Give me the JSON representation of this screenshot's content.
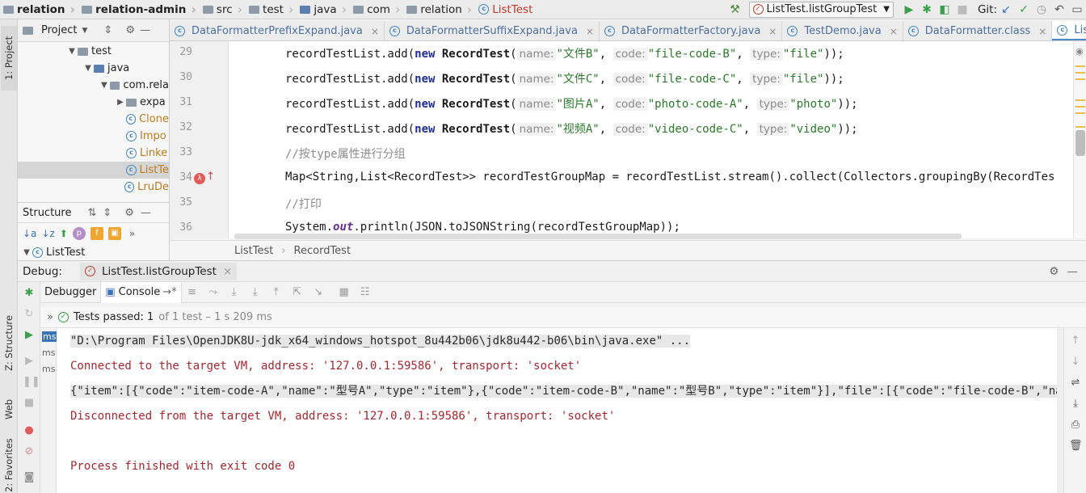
{
  "nav": {
    "items": [
      "relation",
      "relation-admin",
      "src",
      "test",
      "java",
      "com",
      "relation",
      "ListTest"
    ],
    "run_config": "ListTest.listGroupTest",
    "git_label": "Git:"
  },
  "left_strip": {
    "project_tab": "1: Project",
    "structure_tab": "Z: Structure",
    "web_tab": "Web",
    "favorites_tab": "2: Favorites"
  },
  "project": {
    "title": "Project",
    "tree": [
      {
        "label": "test",
        "depth": 0,
        "kind": "folder",
        "expanded": true
      },
      {
        "label": "java",
        "depth": 1,
        "kind": "folder-src",
        "expanded": true
      },
      {
        "label": "com.rela",
        "depth": 2,
        "kind": "package",
        "expanded": true
      },
      {
        "label": "expa",
        "depth": 3,
        "kind": "package",
        "expanded": false
      },
      {
        "label": "Clone",
        "depth": 3,
        "kind": "class"
      },
      {
        "label": "Impo",
        "depth": 3,
        "kind": "class"
      },
      {
        "label": "Linke",
        "depth": 3,
        "kind": "class"
      },
      {
        "label": "ListTe",
        "depth": 3,
        "kind": "class",
        "selected": true
      },
      {
        "label": "LruDe",
        "depth": 3,
        "kind": "class"
      }
    ]
  },
  "structure": {
    "title": "Structure",
    "root": "ListTest"
  },
  "tabs": [
    {
      "label": "DataFormatterPrefixExpand.java"
    },
    {
      "label": "DataFormatterSuffixExpand.java"
    },
    {
      "label": "DataFormatterFactory.java"
    },
    {
      "label": "TestDemo.java"
    },
    {
      "label": "DataFormatter.class"
    },
    {
      "label": "ListTest.java",
      "active": true
    }
  ],
  "tabs_more": "≡4",
  "editor": {
    "line_numbers": [
      "29",
      "30",
      "31",
      "32",
      "33",
      "34",
      "35",
      "36"
    ],
    "lines": [
      {
        "a": "recordTestList.add(",
        "b": "new ",
        "c": "RecordTest",
        "d": "(",
        "h1": "name:",
        "s1": "\"文件B\"",
        "h2": "code:",
        "s2": "\"file-code-B\"",
        "h3": "type:",
        "s3": "\"file\"",
        "e": "));"
      },
      {
        "a": "recordTestList.add(",
        "b": "new ",
        "c": "RecordTest",
        "d": "(",
        "h1": "name:",
        "s1": "\"文件C\"",
        "h2": "code:",
        "s2": "\"file-code-C\"",
        "h3": "type:",
        "s3": "\"file\"",
        "e": "));"
      },
      {
        "a": "recordTestList.add(",
        "b": "new ",
        "c": "RecordTest",
        "d": "(",
        "h1": "name:",
        "s1": "\"图片A\"",
        "h2": "code:",
        "s2": "\"photo-code-A\"",
        "h3": "type:",
        "s3": "\"photo\"",
        "e": "));"
      },
      {
        "a": "recordTestList.add(",
        "b": "new ",
        "c": "RecordTest",
        "d": "(",
        "h1": "name:",
        "s1": "\"视频A\"",
        "h2": "code:",
        "s2": "\"video-code-C\"",
        "h3": "type:",
        "s3": "\"video\"",
        "e": "));"
      }
    ],
    "comment1": "//按type属性进行分组",
    "line34": "Map<String,List<RecordTest>> recordTestGroupMap = recordTestList.stream().collect(Collectors.groupingBy(RecordTes",
    "comment2": "//打印",
    "line36a": "System.",
    "line36b": "out",
    "line36c": ".println(JSON.toJSONString(recordTestGroupMap));",
    "breadcrumb": [
      "ListTest",
      "RecordTest"
    ]
  },
  "debug": {
    "label": "Debug:",
    "session": "ListTest.listGroupTest",
    "tab_debugger": "Debugger",
    "tab_console": "Console",
    "tests_passed": "Tests passed: 1",
    "tests_of": "of 1 test – 1 s 209 ms",
    "ms_labels": [
      "ms",
      "ms",
      "ms"
    ]
  },
  "console": {
    "lines": [
      {
        "text": "\"D:\\Program Files\\OpenJDK8U-jdk_x64_windows_hotspot_8u442b06\\jdk8u442-b06\\bin\\java.exe\" ...",
        "style": "dark",
        "hl": true
      },
      {
        "text": "Connected to the target VM, address: '127.0.0.1:59586', transport: 'socket'",
        "style": "red"
      },
      {
        "text": "{\"item\":[{\"code\":\"item-code-A\",\"name\":\"型号A\",\"type\":\"item\"},{\"code\":\"item-code-B\",\"name\":\"型号B\",\"type\":\"item\"}],\"file\":[{\"code\":\"file-code-B\",\"name\":\"文",
        "style": "dark",
        "hl": true
      },
      {
        "text": "Disconnected from the target VM, address: '127.0.0.1:59586', transport: 'socket'",
        "style": "red"
      },
      {
        "text": "",
        "style": "dark"
      },
      {
        "text": "Process finished with exit code 0",
        "style": "red"
      }
    ]
  },
  "colors": {
    "accent": "#3d6fb5",
    "console_red": "#a8262f",
    "pass_green": "#3aa04a"
  }
}
